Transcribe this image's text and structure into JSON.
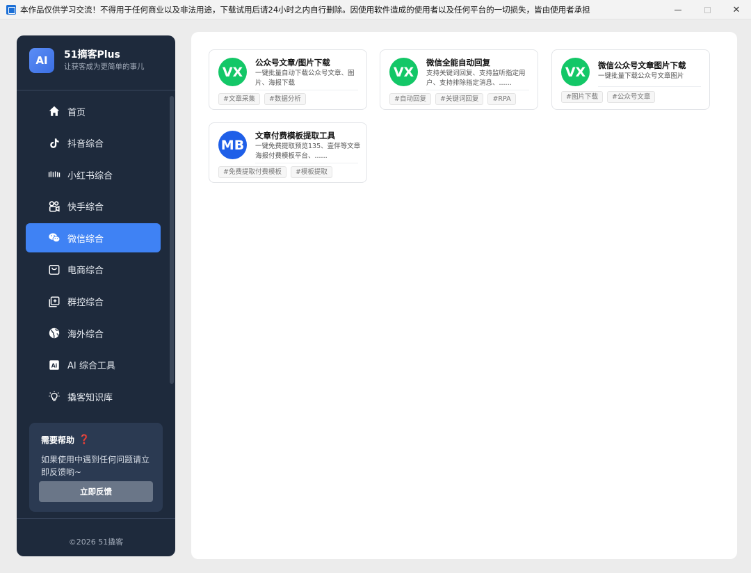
{
  "window": {
    "title": "本作品仅供学习交流！不得用于任何商业以及非法用途，下载试用后请24小时之内自行删除。因使用软件造成的使用者以及任何平台的一切损失，皆由使用者承担",
    "controls": {
      "minimize": "",
      "maximize": "",
      "close": "✕"
    }
  },
  "brand": {
    "logo": "AI",
    "name": "51摘客Plus",
    "slogan": "让获客成为更简单的事儿"
  },
  "nav": {
    "active": "微信综合",
    "items": [
      {
        "label": "首页",
        "icon": "home-icon"
      },
      {
        "label": "抖音综合",
        "icon": "tiktok-icon"
      },
      {
        "label": "小红书综合",
        "icon": "xiaohongshu-icon"
      },
      {
        "label": "快手综合",
        "icon": "kuaishou-icon"
      },
      {
        "label": "微信综合",
        "icon": "wechat-icon"
      },
      {
        "label": "电商综合",
        "icon": "shopping-bag-icon"
      },
      {
        "label": "群控综合",
        "icon": "group-control-icon"
      },
      {
        "label": "海外综合",
        "icon": "globe-icon"
      },
      {
        "label": "AI 综合工具",
        "icon": "ai-icon"
      },
      {
        "label": "撬客知识库",
        "icon": "lightbulb-icon"
      }
    ]
  },
  "help": {
    "title": "需要帮助",
    "icon": "question-icon",
    "icon_glyph": "❓",
    "text": "如果使用中遇到任何问题请立即反馈哟~",
    "button": "立即反馈"
  },
  "footer": {
    "copyright": "©2026 51撬客"
  },
  "colors": {
    "sidebar_bg": "#1e2a3c",
    "accent": "#3f82f4",
    "wechat_green": "#13c767",
    "mb_blue": "#1f5fe8"
  },
  "cards": [
    {
      "avatar": "VX",
      "avatar_color": "#13c767",
      "title": "公众号文章/图片下载",
      "desc": "一键批量自动下载公众号文章、图片、海报下载",
      "tags": [
        "#文章采集",
        "#数据分析"
      ]
    },
    {
      "avatar": "VX",
      "avatar_color": "#13c767",
      "title": "微信全能自动回复",
      "desc": "支持关键词回复、支持监听指定用户、支持排除指定消息、......",
      "tags": [
        "#自动回复",
        "#关键词回复",
        "#RPA"
      ]
    },
    {
      "avatar": "VX",
      "avatar_color": "#13c767",
      "title": "微信公众号文章图片下载",
      "desc": "一键批量下载公众号文章图片",
      "tags": [
        "#图片下载",
        "#公众号文章"
      ]
    },
    {
      "avatar": "MB",
      "avatar_color": "#1f5fe8",
      "title": "文章付费模板提取工具",
      "desc": "一键免费提取预览135、壹伴等文章海报付费模板平台、......",
      "tags": [
        "#免费提取付费模板",
        "#模板提取"
      ]
    }
  ]
}
